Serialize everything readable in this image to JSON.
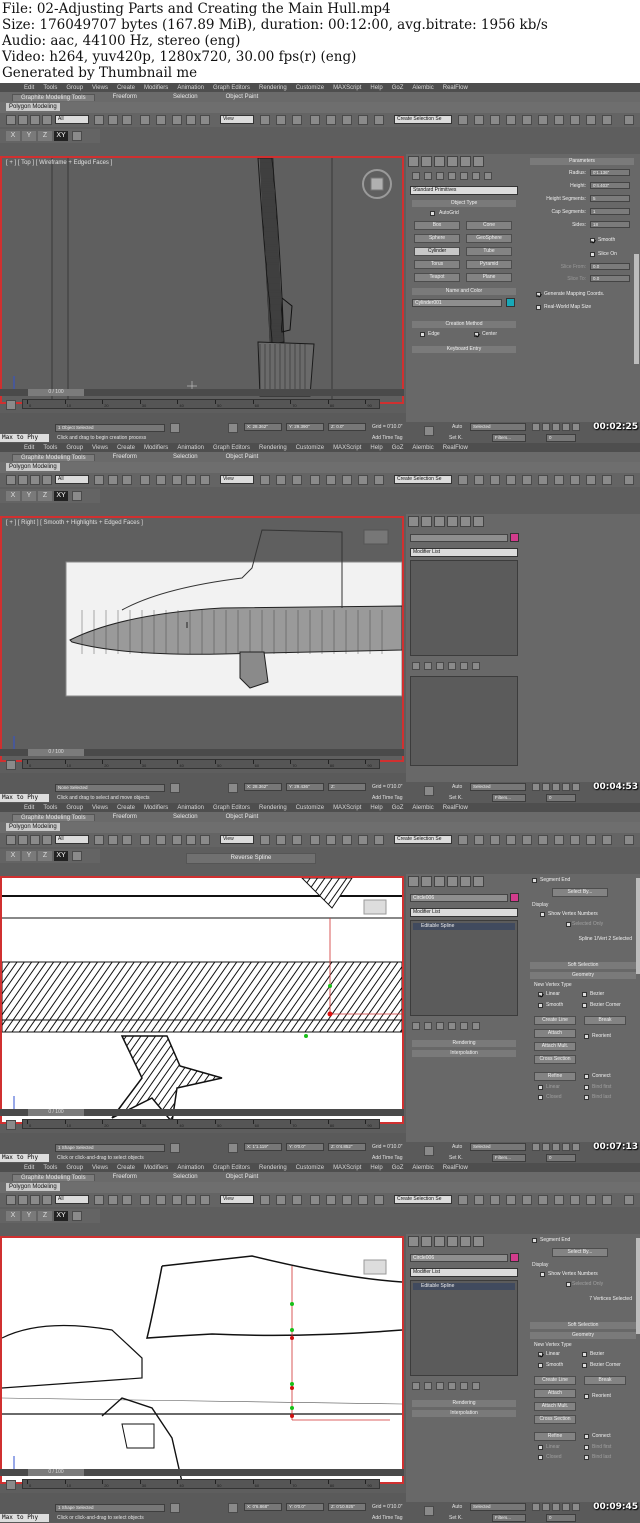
{
  "header": {
    "line1": "File: 02-Adjusting Parts and Creating the Main Hull.mp4",
    "line2": "Size: 176049707 bytes (167.89 MiB), duration: 00:12:00, avg.bitrate: 1956 kb/s",
    "line3": "Audio: aac, 44100 Hz, stereo (eng)",
    "line4": "Video: h264, yuv420p, 1280x720, 30.00 fps(r) (eng)",
    "line5": "Generated by Thumbnail me"
  },
  "menu": [
    "Edit",
    "Tools",
    "Group",
    "Views",
    "Create",
    "Modifiers",
    "Animation",
    "Graph Editors",
    "Rendering",
    "Customize",
    "MAXScript",
    "Help",
    "GoZ",
    "Alembic",
    "RealFlow"
  ],
  "ribbon": {
    "tabs": [
      "Graphite Modeling Tools",
      "Freeform",
      "Selection",
      "Object Paint"
    ],
    "sub_label": "Polygon Modeling"
  },
  "toolbar": {
    "filter": "All",
    "ref_coord": "View",
    "named_sel": "Create Selection Se",
    "axes": [
      "X",
      "Y",
      "Z",
      "XY"
    ],
    "axis_icon_names": [
      "x-axis-icon",
      "y-axis-icon",
      "z-axis-icon",
      "xy-plane-icon"
    ]
  },
  "common": {
    "maxscript": "Max to Phy",
    "time": "0 / 100",
    "ruler_ticks": [
      "0",
      "10",
      "20",
      "30",
      "40",
      "50",
      "60",
      "70",
      "80",
      "90"
    ],
    "auto": "Auto",
    "setk": "Set K.",
    "selected": "Selected",
    "filters": "Filters...",
    "add_time_tag": "Add Time Tag",
    "frame_num": "0",
    "accent_red": "#d03030",
    "swatch_magenta": "#d23c8c",
    "swatch_teal": "#18a8b8"
  },
  "frames": [
    {
      "timestamp": "00:02:25",
      "viewport_label": "[ + ] [ Top ] [ Wireframe + Edged Faces ]",
      "status_sel": "1 Object Selected",
      "status_prompt": "Click and drag to begin creation process",
      "coord_x": "X: 28.362\"",
      "coord_y": "Y: 29.390\"",
      "coord_z": "Z: 0.0\"",
      "grid": "Grid = 0'10.0\"",
      "panel": {
        "category": "Standard Primitives",
        "object_type_hdr": "Object Type",
        "autogrid": "AutoGrid",
        "buttons": [
          "Box",
          "Cone",
          "Sphere",
          "GeoSphere",
          "Cylinder",
          "Tube",
          "Torus",
          "Pyramid",
          "Teapot",
          "Plane"
        ],
        "name_color_hdr": "Name and Color",
        "object_name": "Cylinder001",
        "creation_hdr": "Creation Method",
        "edge": "Edge",
        "center": "Center",
        "keyboard_hdr": "Keyboard Entry",
        "params_hdr": "Parameters",
        "radius_label": "Radius:",
        "radius": "0'1.136\"",
        "height_label": "Height:",
        "height": "0'4.403\"",
        "height_seg_label": "Height Segments:",
        "height_seg": "5",
        "cap_seg_label": "Cap Segments:",
        "cap_seg": "1",
        "sides_label": "Sides:",
        "sides": "18",
        "smooth": "Smooth",
        "slice_on": "Slice On",
        "slice_from": "Slice From:",
        "slice_to": "Slice To:",
        "slice_val": "0.0",
        "gen_map": "Generate Mapping Coords.",
        "real_world": "Real-World Map Size"
      }
    },
    {
      "timestamp": "00:04:53",
      "viewport_label": "[ + ] [ Right ] [ Smooth + Highlights + Edged Faces ]",
      "status_sel": "None Selected",
      "status_prompt": "Click and drag to select and move objects",
      "coord_x": "X: 28.362\"",
      "coord_y": "Y: 29.436\"",
      "coord_z": "Z:",
      "grid": "Grid = 0'10.0\"",
      "panel": {
        "modifier_list": "Modifier List"
      }
    },
    {
      "timestamp": "00:07:13",
      "viewport_label": "",
      "float_toolbar": "Reverse Spline",
      "status_sel": "1 Shape Selected",
      "status_prompt": "Click or click-and-drag to select objects",
      "coord_x": "X: 1'1.119\"",
      "coord_y": "Y: 0'0.0\"",
      "coord_z": "Z: 0'4.852\"",
      "grid": "Grid = 0'10.0\"",
      "panel": {
        "object_name": "Circle006",
        "modifier_list": "Modifier List",
        "stack_item": "Editable Spline",
        "rendering": "Rendering",
        "interpolation": "Interpolation",
        "segment_end": "Segment End",
        "select_by": "Select By...",
        "display": "Display",
        "show_vertex": "Show Vertex Numbers",
        "selected_only": "Selected Only",
        "sel_status": "Spline 1/Vert 2 Selected",
        "soft_selection": "Soft Selection",
        "geometry": "Geometry",
        "new_vertex_type": "New Vertex Type",
        "linear": "Linear",
        "bezier": "Bezier",
        "smooth": "Smooth",
        "bezier_corner": "Bezier Corner",
        "create_line": "Create Line",
        "break": "Break",
        "attach": "Attach",
        "reorient": "Reorient",
        "attach_mult": "Attach Mult.",
        "cross_section": "Cross Section",
        "refine": "Refine",
        "connect": "Connect",
        "linear2": "Linear",
        "bind_first": "Bind first",
        "closed": "Closed",
        "bind_last": "Bind last"
      }
    },
    {
      "timestamp": "00:09:45",
      "viewport_label": "",
      "status_sel": "1 Shape Selected",
      "status_prompt": "Click or click-and-drag to select objects",
      "coord_x": "X: 0'6.868\"",
      "coord_y": "Y: 0'0.0\"",
      "coord_z": "Z: 0'10.925\"",
      "grid": "Grid = 0'10.0\"",
      "panel": {
        "object_name": "Circle006",
        "modifier_list": "Modifier List",
        "stack_item": "Editable Spline",
        "rendering": "Rendering",
        "interpolation": "Interpolation",
        "segment_end": "Segment End",
        "select_by": "Select By...",
        "display": "Display",
        "show_vertex": "Show Vertex Numbers",
        "selected_only": "Selected Only",
        "sel_status": "7 Vertices Selected",
        "soft_selection": "Soft Selection",
        "geometry": "Geometry",
        "new_vertex_type": "New Vertex Type",
        "linear": "Linear",
        "bezier": "Bezier",
        "smooth": "Smooth",
        "bezier_corner": "Bezier Corner",
        "create_line": "Create Line",
        "break": "Break",
        "attach": "Attach",
        "reorient": "Reorient",
        "attach_mult": "Attach Mult.",
        "cross_section": "Cross Section",
        "refine": "Refine",
        "connect": "Connect",
        "linear2": "Linear",
        "bind_first": "Bind first",
        "closed": "Closed",
        "bind_last": "Bind last"
      }
    }
  ]
}
